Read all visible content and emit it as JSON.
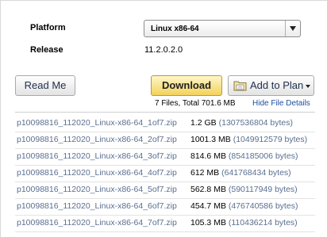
{
  "platform": {
    "label": "Platform",
    "selected": "Linux x86-64"
  },
  "release": {
    "label": "Release",
    "value": "11.2.0.2.0"
  },
  "buttons": {
    "readme": "Read Me",
    "download": "Download",
    "add_to_plan": "Add to Plan"
  },
  "summary": {
    "files_total": "7 Files, Total 701.6 MB",
    "hide_details": "Hide File Details"
  },
  "files": [
    {
      "name": "p10098816_112020_Linux-x86-64_1of7.zip",
      "size": "1.2 GB",
      "bytes": "(1307536804 bytes)"
    },
    {
      "name": "p10098816_112020_Linux-x86-64_2of7.zip",
      "size": "1001.3 MB",
      "bytes": "(1049912579 bytes)"
    },
    {
      "name": "p10098816_112020_Linux-x86-64_3of7.zip",
      "size": "814.6 MB",
      "bytes": "(854185006 bytes)"
    },
    {
      "name": "p10098816_112020_Linux-x86-64_4of7.zip",
      "size": "612 MB",
      "bytes": "(641768434 bytes)"
    },
    {
      "name": "p10098816_112020_Linux-x86-64_5of7.zip",
      "size": "562.8 MB",
      "bytes": "(590117949 bytes)"
    },
    {
      "name": "p10098816_112020_Linux-x86-64_6of7.zip",
      "size": "454.7 MB",
      "bytes": "(476740586 bytes)"
    },
    {
      "name": "p10098816_112020_Linux-x86-64_7of7.zip",
      "size": "105.3 MB",
      "bytes": "(110436214 bytes)"
    }
  ],
  "icons": {
    "select_arrow": "chevron-down-icon",
    "plan_folder": "folder-icon",
    "plan_caret": "caret-down-icon"
  }
}
